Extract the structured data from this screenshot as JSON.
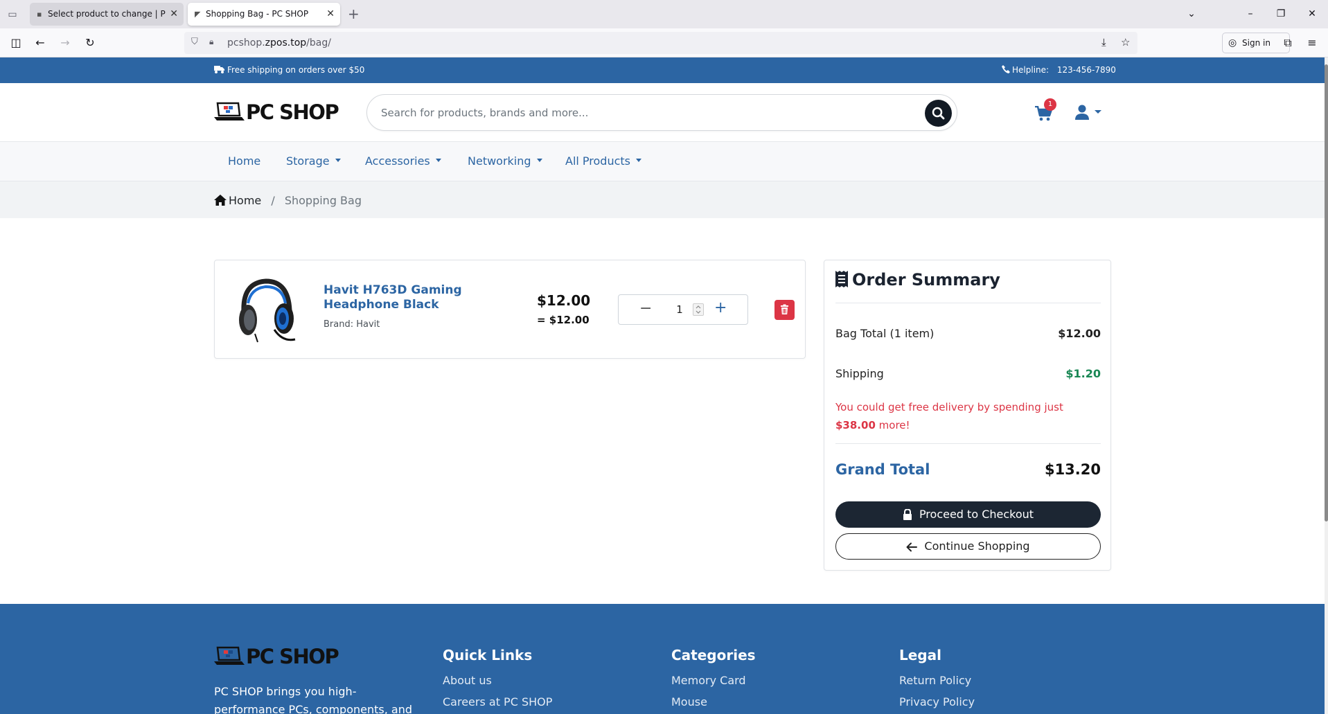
{
  "browser": {
    "tabs": [
      {
        "title": "Select product to change | PCSHOP",
        "active": false
      },
      {
        "title": "Shopping Bag - PC SHOP",
        "active": true
      }
    ],
    "url_prefix": "pcshop.",
    "url_domain": "zpos.top",
    "url_path": "/bag/",
    "signin_label": "Sign in"
  },
  "topbar": {
    "shipping_text": "Free shipping on orders over $50",
    "helpline_label": "Helpline:",
    "helpline_number": "123-456-7890"
  },
  "header": {
    "logo_text": "PC SHOP",
    "search_placeholder": "Search for products, brands and more...",
    "cart_count": "1"
  },
  "menu": {
    "items": [
      {
        "label": "Home",
        "dropdown": false
      },
      {
        "label": "Storage",
        "dropdown": true
      },
      {
        "label": "Accessories",
        "dropdown": true
      },
      {
        "label": "Networking",
        "dropdown": true
      },
      {
        "label": "All Products",
        "dropdown": true
      }
    ]
  },
  "breadcrumb": {
    "home": "Home",
    "separator": "/",
    "current": "Shopping Bag"
  },
  "cart": {
    "items": [
      {
        "name": "Havit H763D Gaming Headphone Black",
        "brand": "Brand: Havit",
        "price": "$12.00",
        "subtotal": "= $12.00",
        "quantity": "1"
      }
    ]
  },
  "summary": {
    "title": "Order Summary",
    "bag_total_label": "Bag Total (1 item)",
    "bag_total_value": "$12.00",
    "shipping_label": "Shipping",
    "shipping_value": "$1.20",
    "notice_prefix": "You could get free delivery by spending just",
    "notice_amount": "$38.00",
    "notice_suffix": "more!",
    "grand_total_label": "Grand Total",
    "grand_total_value": "$13.20",
    "checkout_label": "Proceed to Checkout",
    "continue_label": "Continue Shopping"
  },
  "footer": {
    "logo_text": "PC SHOP",
    "about": "PC SHOP brings you high-performance PCs, components, and accessories to",
    "columns": [
      {
        "title": "Quick Links",
        "links": [
          "About us",
          "Careers at PC SHOP"
        ]
      },
      {
        "title": "Categories",
        "links": [
          "Memory Card",
          "Mouse"
        ]
      },
      {
        "title": "Legal",
        "links": [
          "Return Policy",
          "Privacy Policy"
        ]
      }
    ]
  },
  "colors": {
    "brand_blue": "#2c65a3",
    "dark": "#1c2633",
    "danger": "#dc3545",
    "success": "#198754"
  },
  "icons": [
    "truck-icon",
    "phone-icon",
    "search-icon",
    "cart-icon",
    "user-icon",
    "home-icon",
    "trash-icon",
    "receipt-icon",
    "lock-icon",
    "arrow-left-icon"
  ]
}
